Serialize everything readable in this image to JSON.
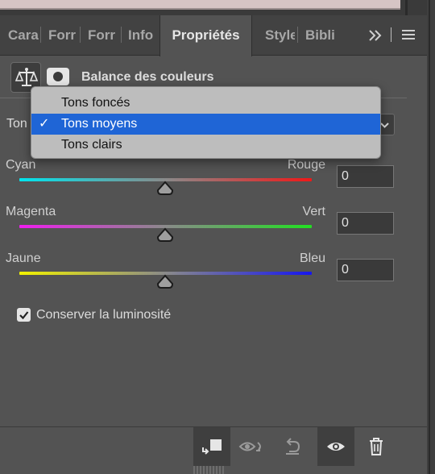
{
  "tabs": [
    {
      "label": "Cara",
      "active": false
    },
    {
      "label": "Forr",
      "active": false
    },
    {
      "label": "Forr",
      "active": false
    },
    {
      "label": "Info",
      "active": false
    },
    {
      "label": "Propriétés",
      "active": true
    },
    {
      "label": "Style",
      "active": false
    },
    {
      "label": "Bibli",
      "active": false
    }
  ],
  "tabbar": {
    "overflow_glyph": "›› |"
  },
  "panel": {
    "title": "Balance des couleurs"
  },
  "tone": {
    "label": "Ton",
    "selected": "Tons moyens",
    "options": [
      "Tons foncés",
      "Tons moyens",
      "Tons clairs"
    ]
  },
  "sliders": [
    {
      "left": "Cyan",
      "right": "Rouge",
      "value": "0",
      "from_color": "#00e5ee",
      "to_color": "#f01818"
    },
    {
      "left": "Magenta",
      "right": "Vert",
      "value": "0",
      "from_color": "#f01ef0",
      "to_color": "#22e022"
    },
    {
      "left": "Jaune",
      "right": "Bleu",
      "value": "0",
      "from_color": "#f2f200",
      "to_color": "#1616f0"
    }
  ],
  "preserve_luminosity": {
    "label": "Conserver la luminosité",
    "checked": true
  },
  "bottom_bar": [
    "clip-to-layer-icon",
    "view-previous-state-icon",
    "reset-icon",
    "visibility-eye-icon",
    "trash-icon"
  ],
  "colors": {
    "panel_bg": "#535353",
    "selection_blue": "#1f65d6"
  }
}
